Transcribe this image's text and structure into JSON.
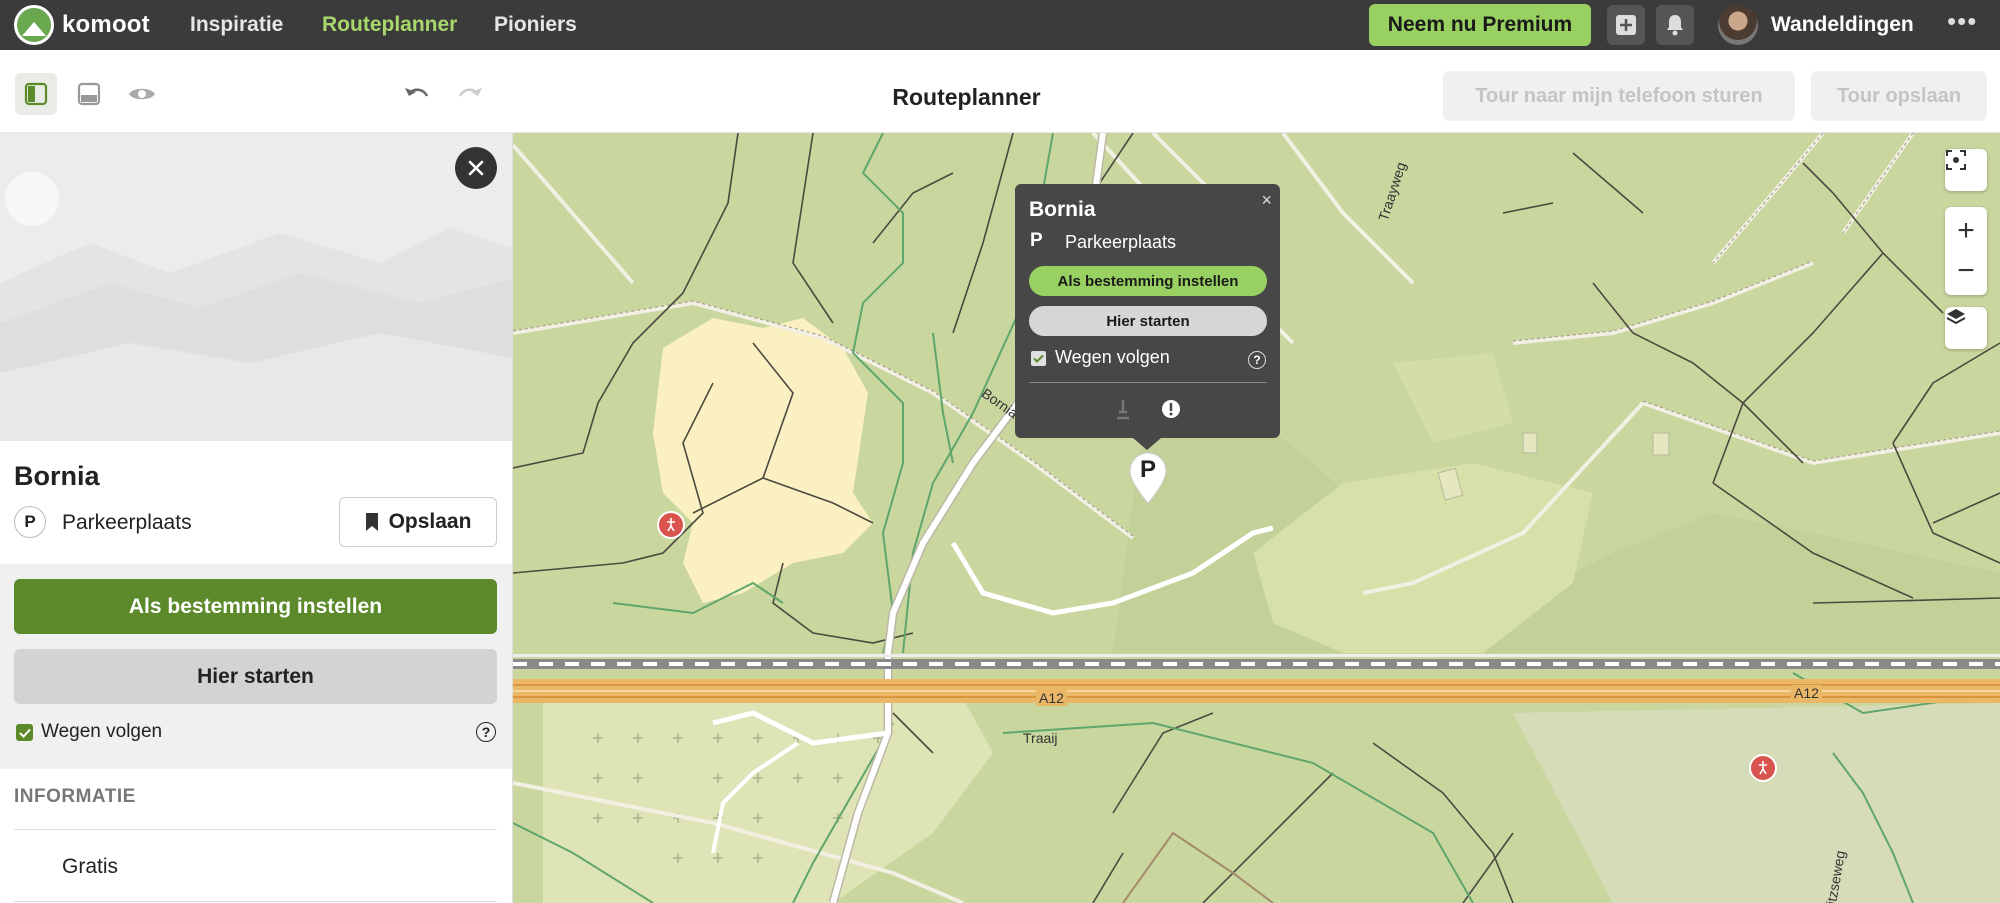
{
  "nav": {
    "brand": "komoot",
    "links": [
      "Inspiratie",
      "Routeplanner",
      "Pioniers"
    ],
    "premium_label": "Neem nu Premium",
    "username": "Wandeldingen",
    "more_label": "•••"
  },
  "toolbar": {
    "title": "Routeplanner",
    "send_label": "Tour naar mijn telefoon sturen",
    "save_label": "Tour opslaan"
  },
  "place": {
    "name": "Bornia",
    "type_icon": "P",
    "type": "Parkeerplaats",
    "save_label": "Opslaan",
    "dest_label": "Als bestemming instellen",
    "start_label": "Hier starten",
    "follow_roads_label": "Wegen volgen",
    "info_heading": "INFORMATIE",
    "info_value": "Gratis"
  },
  "popup": {
    "title": "Bornia",
    "type_icon": "P",
    "type": "Parkeerplaats",
    "dest_label": "Als bestemming instellen",
    "start_label": "Hier starten",
    "follow_roads_label": "Wegen volgen",
    "close_label": "×"
  },
  "map": {
    "labels": {
      "road_a12_left": "A12",
      "road_a12_right": "A12",
      "traaij": "Traaij",
      "traayweg": "Traayweg",
      "bornia_road": "Bornia",
      "street_bottom": "itzseweg"
    },
    "pin_label": "P",
    "zoom_in": "+",
    "zoom_out": "−"
  },
  "colors": {
    "accent": "#98d161",
    "primary_green": "#5c8a2a",
    "nav_bg": "#3b3b3b",
    "map_bg": "#c9d69e"
  }
}
